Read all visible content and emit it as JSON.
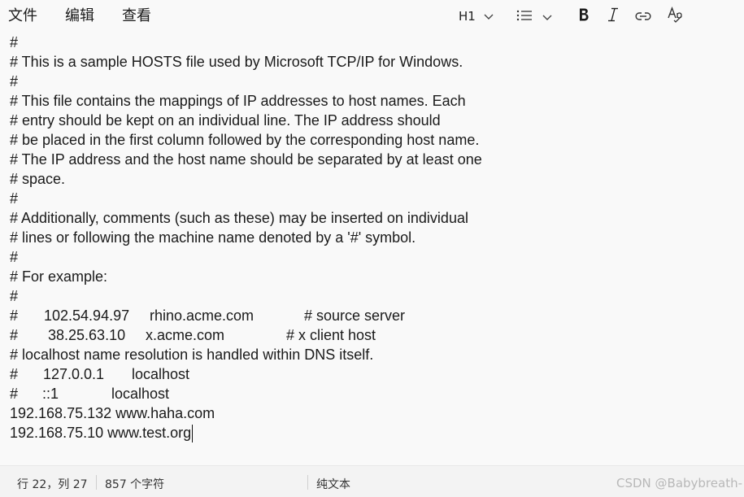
{
  "menu": {
    "file": "文件",
    "edit": "编辑",
    "view": "查看"
  },
  "toolbar": {
    "heading": "H1",
    "icons": [
      "chevron-down-icon",
      "bulleted-list-icon",
      "bold-icon",
      "italic-icon",
      "link-icon",
      "spellcheck-icon"
    ]
  },
  "editor": {
    "lines": [
      "#",
      "# This is a sample HOSTS file used by Microsoft TCP/IP for Windows.",
      "#",
      "# This file contains the mappings of IP addresses to host names. Each",
      "# entry should be kept on an individual line. The IP address should",
      "# be placed in the first column followed by the corresponding host name.",
      "# The IP address and the host name should be separated by at least one",
      "# space.",
      "#",
      "# Additionally, comments (such as these) may be inserted on individual",
      "# lines or following the machine name denoted by a '#' symbol.",
      "#",
      "# For example:",
      "#"
    ],
    "example1": {
      "hash": "#",
      "ip": "102.54.94.97",
      "host": "rhino.acme.com",
      "comment": "# source server"
    },
    "example2": {
      "hash": "#",
      "ip": "38.25.63.10",
      "host": "x.acme.com",
      "comment": "# x client host"
    },
    "line_dns": "# localhost name resolution is handled within DNS itself.",
    "local1": {
      "hash": "#",
      "ip": "127.0.0.1",
      "host": "localhost"
    },
    "local2": {
      "hash": "#",
      "ip": "::1",
      "host": "localhost"
    },
    "entry1": "192.168.75.132 www.haha.com",
    "entry2": "192.168.75.10 www.test.org"
  },
  "status": {
    "position": "行 22，列 27",
    "count": "857 个字符",
    "encoding": "纯文本"
  },
  "watermark": "CSDN @Babybreath-"
}
